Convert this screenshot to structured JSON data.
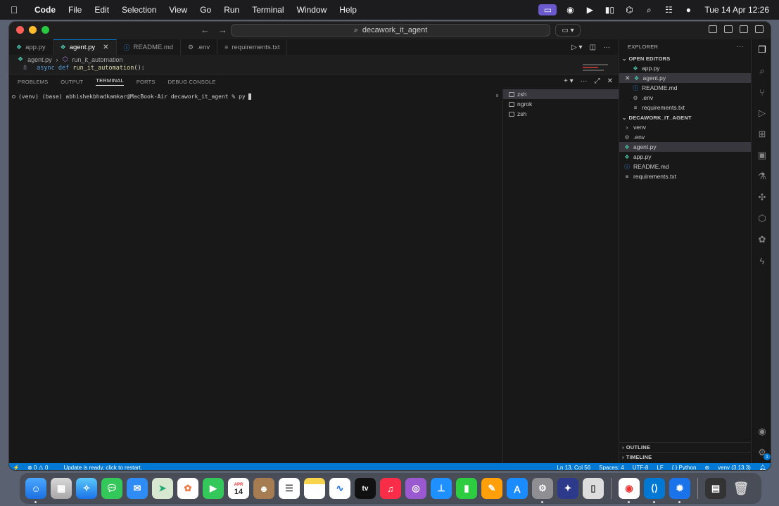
{
  "menubar": {
    "app_name": "Code",
    "items": [
      "File",
      "Edit",
      "Selection",
      "View",
      "Go",
      "Run",
      "Terminal",
      "Window",
      "Help"
    ],
    "clock": "Tue 14 Apr  12:26"
  },
  "titlebar": {
    "search_text": "decawork_it_agent"
  },
  "tabs": [
    {
      "label": "app.py",
      "icon": "python-file-icon"
    },
    {
      "label": "agent.py",
      "icon": "python-file-icon",
      "active": true
    },
    {
      "label": "README.md",
      "icon": "info-file-icon"
    },
    {
      "label": ".env",
      "icon": "gear-file-icon"
    },
    {
      "label": "requirements.txt",
      "icon": "text-file-icon"
    }
  ],
  "breadcrumbs": {
    "file": "agent.py",
    "symbol": "run_it_automation"
  },
  "code": {
    "line_number": "8",
    "keyword1": "async",
    "keyword2": "def",
    "function": "run_it_automation",
    "rest": "():"
  },
  "panel": {
    "tabs": [
      "PROBLEMS",
      "OUTPUT",
      "TERMINAL",
      "PORTS",
      "DEBUG CONSOLE"
    ],
    "active_tab": "TERMINAL",
    "prompt": "(venv) (base) abhishekbhadkamkar@MacBook-Air decawork_it_agent % py",
    "terminals": [
      "zsh",
      "ngrok",
      "zsh"
    ]
  },
  "explorer": {
    "title": "EXPLORER",
    "open_editors_label": "OPEN EDITORS",
    "open_editors": [
      {
        "label": "app.py",
        "type": "py"
      },
      {
        "label": "agent.py",
        "type": "py",
        "selected": true
      },
      {
        "label": "README.md",
        "type": "md"
      },
      {
        "label": ".env",
        "type": "env"
      },
      {
        "label": "requirements.txt",
        "type": "txt"
      }
    ],
    "folder_label": "DECAWORK_IT_AGENT",
    "files": [
      {
        "label": "venv",
        "type": "folder"
      },
      {
        "label": ".env",
        "type": "env"
      },
      {
        "label": "agent.py",
        "type": "py",
        "selected": true
      },
      {
        "label": "app.py",
        "type": "py"
      },
      {
        "label": "README.md",
        "type": "md"
      },
      {
        "label": "requirements.txt",
        "type": "txt"
      }
    ],
    "outline_label": "OUTLINE",
    "timeline_label": "TIMELINE"
  },
  "activity_badge": "1",
  "statusbar": {
    "problems": "⊗ 0 ⚠ 0",
    "update": "Update is ready, click to restart.",
    "position": "Ln 13, Col 56",
    "spaces": "Spaces: 4",
    "encoding": "UTF-8",
    "eol": "LF",
    "language": "{ } Python",
    "interpreter": "venv (3.13.3)"
  },
  "dock": {
    "calendar_month": "APR",
    "calendar_day": "14",
    "tv_label": "tv"
  },
  "colors": {
    "accent": "#0078d4",
    "editor_bg": "#1e1e1e",
    "panel_bg": "#181818"
  }
}
